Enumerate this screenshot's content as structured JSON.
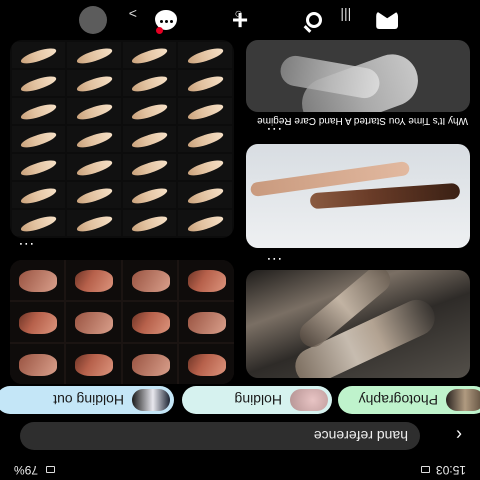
{
  "status_bar": {
    "time": "15:03",
    "battery": "79%"
  },
  "search": {
    "query": "hand reference"
  },
  "chips": [
    {
      "label": "Photography"
    },
    {
      "label": "Holding"
    },
    {
      "label": "Holding out"
    }
  ],
  "pins": [
    {
      "id": "pin-a",
      "menu": "..."
    },
    {
      "id": "pin-b",
      "menu": "...",
      "caption": "Why It's Time You Started A Hand Care Regime"
    },
    {
      "id": "pin-c"
    },
    {
      "id": "pin-d",
      "menu": "..."
    },
    {
      "id": "pin-e"
    }
  ],
  "bottom_nav": [
    {
      "icon": "profile-avatar"
    },
    {
      "icon": "chat-icon"
    },
    {
      "icon": "plus-icon"
    },
    {
      "icon": "search-icon"
    },
    {
      "icon": "home-icon"
    }
  ],
  "system_nav": {
    "back": "<",
    "home": "○",
    "recents": "|||"
  }
}
